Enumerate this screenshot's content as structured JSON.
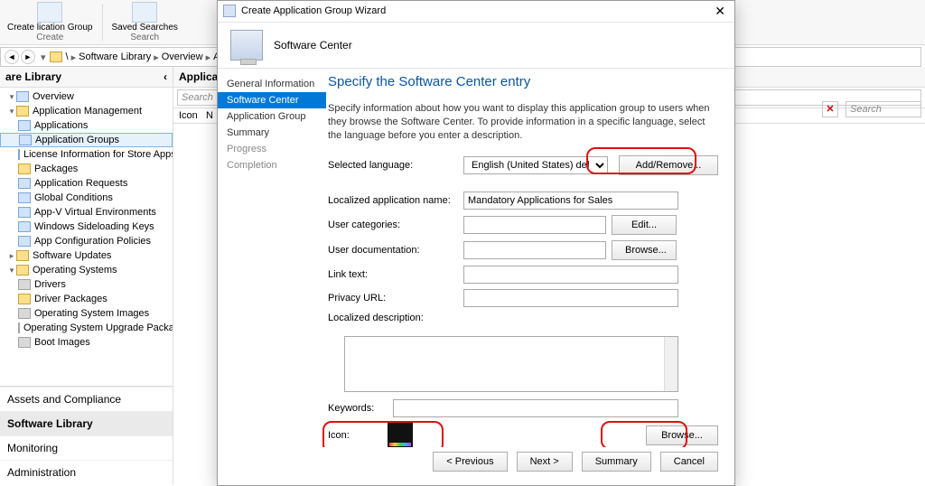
{
  "ribbon": {
    "create_group": "Create\nlication Group",
    "create_caption": "Create",
    "saved_searches": "Saved\nSearches",
    "search_caption": "Search"
  },
  "breadcrumb": {
    "p1": "\\",
    "p2": "Software Library",
    "p3": "Overview",
    "p4": "Ap"
  },
  "nav": {
    "title": "are Library",
    "items": [
      "Overview",
      "Application Management",
      "Applications",
      "Application Groups",
      "License Information for Store Apps",
      "Packages",
      "Application Requests",
      "Global Conditions",
      "App-V Virtual Environments",
      "Windows Sideloading Keys",
      "App Configuration Policies",
      "Software Updates",
      "Operating Systems",
      "Drivers",
      "Driver Packages",
      "Operating System Images",
      "Operating System Upgrade Packages",
      "Boot Images"
    ],
    "wunderbar": [
      "Assets and Compliance",
      "Software Library",
      "Monitoring",
      "Administration"
    ]
  },
  "content": {
    "header": "Applicatio",
    "search_placeholder": "Search",
    "grid_col1": "Icon",
    "grid_col2": "N"
  },
  "right": {
    "search_placeholder": "Search"
  },
  "dialog": {
    "title": "Create Application Group Wizard",
    "banner": "Software Center",
    "steps": [
      "General Information",
      "Software Center",
      "Application Group",
      "Summary",
      "Progress",
      "Completion"
    ],
    "heading": "Specify the Software Center entry",
    "description": "Specify information about how you want to display this application group to users when they browse the Software Center. To provide information in a specific language, select the language before you enter a description.",
    "selected_language_label": "Selected language:",
    "selected_language_value": "English (United States) default",
    "add_remove": "Add/Remove...",
    "fields": {
      "localized_name_label": "Localized application name:",
      "localized_name_value": "Mandatory Applications for Sales",
      "user_categories_label": "User categories:",
      "edit": "Edit...",
      "user_doc_label": "User documentation:",
      "browse": "Browse...",
      "link_text_label": "Link text:",
      "privacy_label": "Privacy URL:",
      "localized_desc_label": "Localized description:",
      "keywords_label": "Keywords:",
      "icon_label": "Icon:",
      "icon_browse": "Browse..."
    },
    "buttons": {
      "previous": "< Previous",
      "next": "Next >",
      "summary": "Summary",
      "cancel": "Cancel"
    }
  }
}
